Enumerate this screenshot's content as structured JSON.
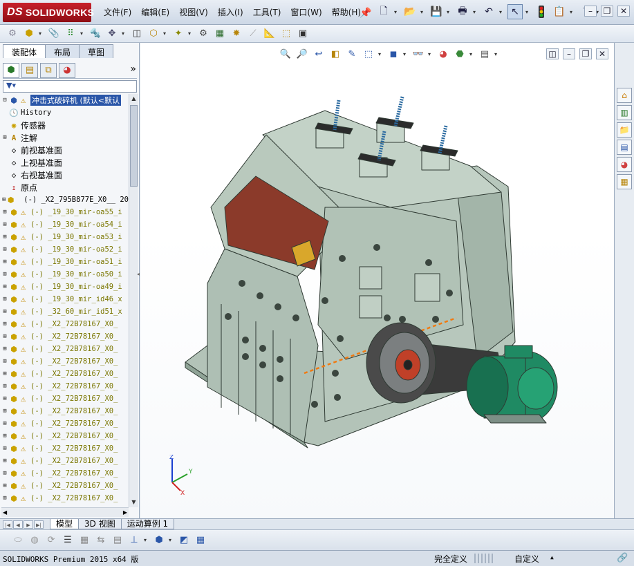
{
  "app": {
    "logo_prefix": "DS",
    "logo_text": "SOLIDWORKS"
  },
  "menu": {
    "items": [
      {
        "label": "文件(F)"
      },
      {
        "label": "编辑(E)"
      },
      {
        "label": "视图(V)"
      },
      {
        "label": "插入(I)"
      },
      {
        "label": "工具(T)"
      },
      {
        "label": "窗口(W)"
      },
      {
        "label": "帮助(H)"
      }
    ]
  },
  "command_manager": {
    "tabs": [
      {
        "label": "装配体",
        "active": true
      },
      {
        "label": "布局",
        "active": false
      },
      {
        "label": "草图",
        "active": false
      }
    ]
  },
  "feature_tree": {
    "root": {
      "label": "冲击式破碎机  (默认<默认"
    },
    "nodes": [
      {
        "label": "History",
        "icon": "history-icon"
      },
      {
        "label": "传感器",
        "icon": "sensor-icon"
      },
      {
        "label": "注解",
        "icon": "annotation-icon"
      },
      {
        "label": "前视基准面",
        "icon": "plane-icon"
      },
      {
        "label": "上视基准面",
        "icon": "plane-icon"
      },
      {
        "label": "右视基准面",
        "icon": "plane-icon"
      },
      {
        "label": "原点",
        "icon": "origin-icon"
      }
    ],
    "components": [
      {
        "label": "(-) _X2_795B877E_X0__ 20",
        "warn": false
      },
      {
        "label": "(-) _19_30_mir-oa55_i",
        "warn": true
      },
      {
        "label": "(-) _19_30_mir-oa54_i",
        "warn": true
      },
      {
        "label": "(-) _19_30_mir-oa53_i",
        "warn": true
      },
      {
        "label": "(-) _19_30_mir-oa52_i",
        "warn": true
      },
      {
        "label": "(-) _19_30_mir-oa51_i",
        "warn": true
      },
      {
        "label": "(-) _19_30_mir-oa50_i",
        "warn": true
      },
      {
        "label": "(-) _19_30_mir-oa49_i",
        "warn": true
      },
      {
        "label": "(-) _19_30_mir_id46_x",
        "warn": true
      },
      {
        "label": "(-) _32_60_mir_id51_x",
        "warn": true
      },
      {
        "label": "(-) _X2_72B78167_X0_",
        "warn": true
      },
      {
        "label": "(-) _X2_72B78167_X0_",
        "warn": true
      },
      {
        "label": "(-) _X2_72B78167_X0_",
        "warn": true
      },
      {
        "label": "(-) _X2_72B78167_X0_",
        "warn": true
      },
      {
        "label": "(-) _X2_72B78167_X0_",
        "warn": true
      },
      {
        "label": "(-) _X2_72B78167_X0_",
        "warn": true
      },
      {
        "label": "(-) _X2_72B78167_X0_",
        "warn": true
      },
      {
        "label": "(-) _X2_72B78167_X0_",
        "warn": true
      },
      {
        "label": "(-) _X2_72B78167_X0_",
        "warn": true
      },
      {
        "label": "(-) _X2_72B78167_X0_",
        "warn": true
      },
      {
        "label": "(-) _X2_72B78167_X0_",
        "warn": true
      },
      {
        "label": "(-) _X2_72B78167_X0_",
        "warn": true
      },
      {
        "label": "(-) _X2_72B78167_X0_",
        "warn": true
      },
      {
        "label": "(-) _X2_72B78167_X0_",
        "warn": true
      },
      {
        "label": "(-) _X2_72B78167_X0_",
        "warn": true
      },
      {
        "label": "(-) _X2_72B78167_X0_",
        "warn": true
      }
    ]
  },
  "bottom_tabs": [
    {
      "label": "模型",
      "active": true
    },
    {
      "label": "3D 视图",
      "active": false
    },
    {
      "label": "运动算例 1",
      "active": false
    }
  ],
  "status": {
    "product": "SOLIDWORKS Premium 2015 x64 版",
    "definition": "完全定义",
    "units": "自定义"
  },
  "triad": {
    "x": "X",
    "y": "Y",
    "z": "Z"
  },
  "colors": {
    "machine_body": "#aebfb4",
    "machine_edge": "#2f3a33",
    "liner": "#8b3a2a",
    "motor": "#1f8a63",
    "accent_orange": "#f07a12",
    "selection_blue": "#2a56a8"
  }
}
